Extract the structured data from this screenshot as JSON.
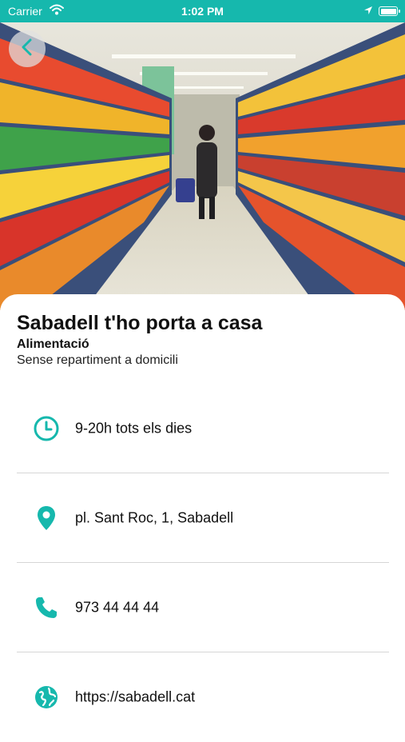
{
  "status_bar": {
    "carrier": "Carrier",
    "time": "1:02 PM"
  },
  "colors": {
    "accent": "#16b8ad",
    "text": "#111111"
  },
  "hero": {
    "image": "supermarket-aisle-photo"
  },
  "shop": {
    "name": "Sabadell t'ho porta a casa",
    "category": "Alimentació",
    "delivery": "Sense repartiment a domicili"
  },
  "details": {
    "hours": "9-20h tots els dies",
    "address": "pl. Sant Roc, 1, Sabadell",
    "phone": "973 44 44 44",
    "website": "https://sabadell.cat"
  },
  "icons": {
    "back": "chevron-left-icon",
    "hours": "clock-icon",
    "address": "map-pin-icon",
    "phone": "phone-icon",
    "website": "globe-icon"
  }
}
